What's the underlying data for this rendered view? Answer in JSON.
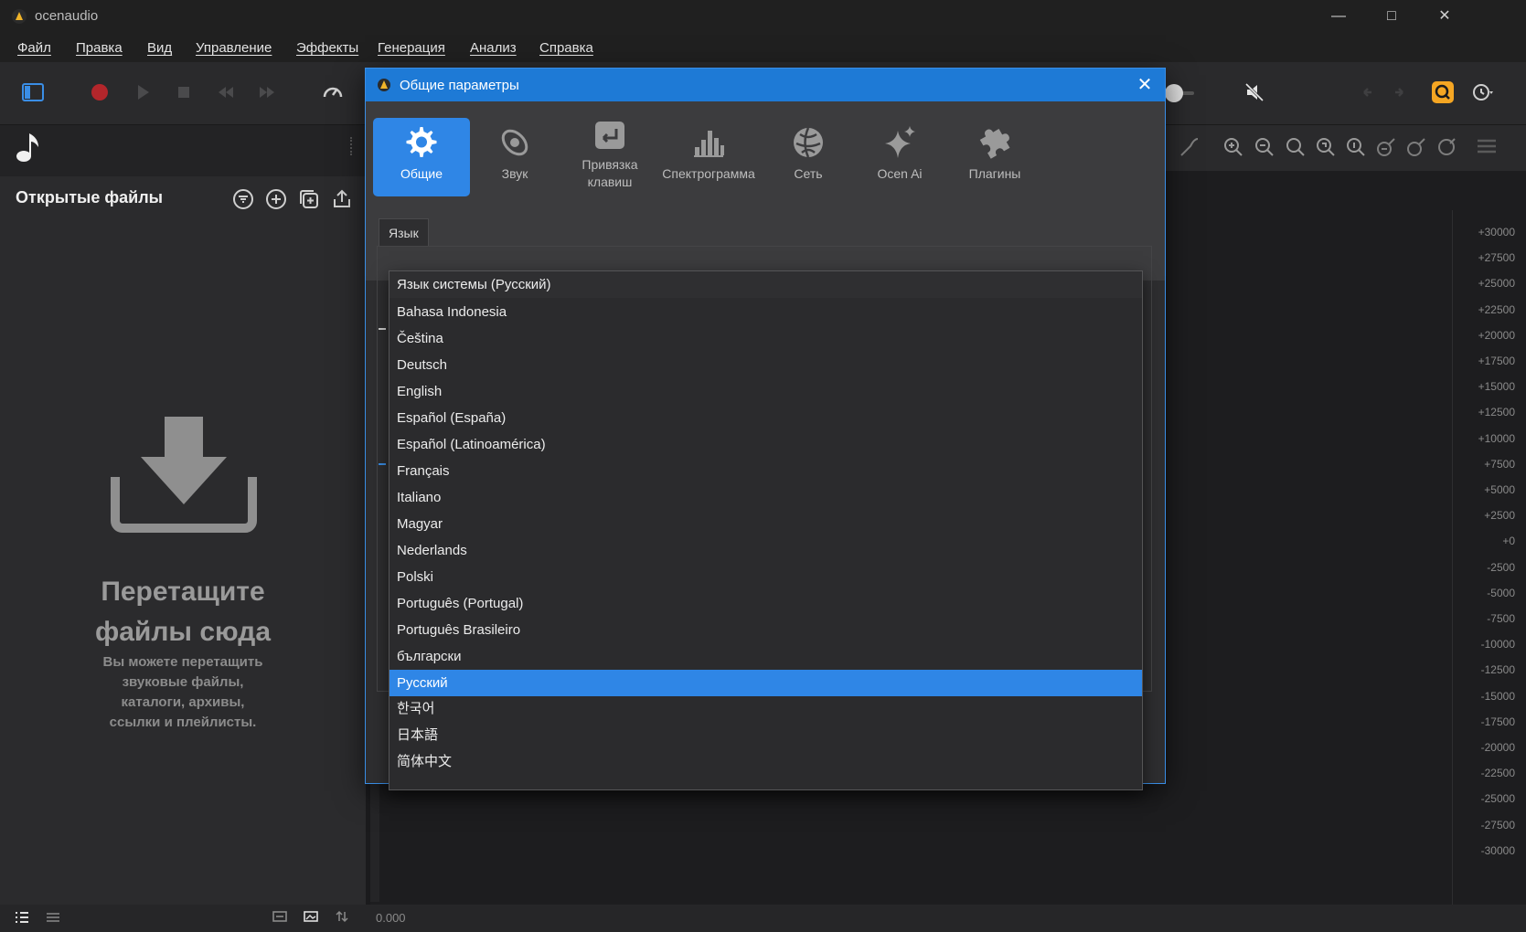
{
  "window": {
    "title": "ocenaudio"
  },
  "menu": [
    "Файл",
    "Правка",
    "Вид",
    "Управление",
    "Эффекты",
    "Генерация",
    "Анализ",
    "Справка"
  ],
  "left_panel": {
    "title": "Открытые файлы",
    "drop_title_line1": "Перетащите",
    "drop_title_line2": "файлы сюда",
    "drop_sub_line1": "Вы можете перетащить",
    "drop_sub_line2": "звуковые файлы,",
    "drop_sub_line3": "каталоги, архивы,",
    "drop_sub_line4": "ссылки и плейлисты."
  },
  "dialog": {
    "title": "Общие параметры",
    "tabs": [
      {
        "label": "Общие",
        "icon": "gear-icon"
      },
      {
        "label": "Звук",
        "icon": "sound-icon"
      },
      {
        "label1": "Привязка",
        "label2": "клавиш",
        "icon": "keybinding-icon"
      },
      {
        "label": "Спектрограмма",
        "icon": "spectrogram-icon"
      },
      {
        "label": "Сеть",
        "icon": "network-icon"
      },
      {
        "label": "Ocen Ai",
        "icon": "sparkle-icon"
      },
      {
        "label": "Плагины",
        "icon": "puzzle-icon"
      }
    ],
    "section_label": "Язык",
    "languages": [
      "Язык системы (Русский)",
      "Bahasa Indonesia",
      "Čeština",
      "Deutsch",
      "English",
      "Español (España)",
      "Español (Latinoamérica)",
      "Français",
      "Italiano",
      "Magyar",
      "Nederlands",
      "Polski",
      "Português (Portugal)",
      "Português Brasileiro",
      "български",
      "Русский",
      "한국어",
      "日本語",
      "简体中文"
    ],
    "selected_language": "Русский"
  },
  "axis_labels": [
    "+30000",
    "+27500",
    "+25000",
    "+22500",
    "+20000",
    "+17500",
    "+15000",
    "+12500",
    "+10000",
    "+7500",
    "+5000",
    "+2500",
    "+0",
    "-2500",
    "-5000",
    "-7500",
    "-10000",
    "-12500",
    "-15000",
    "-17500",
    "-20000",
    "-22500",
    "-25000",
    "-27500",
    "-30000"
  ],
  "status": {
    "time": "0.000"
  },
  "colors": {
    "accent": "#2f86e6",
    "record": "#b3262b",
    "highlight": "#f5a623"
  }
}
